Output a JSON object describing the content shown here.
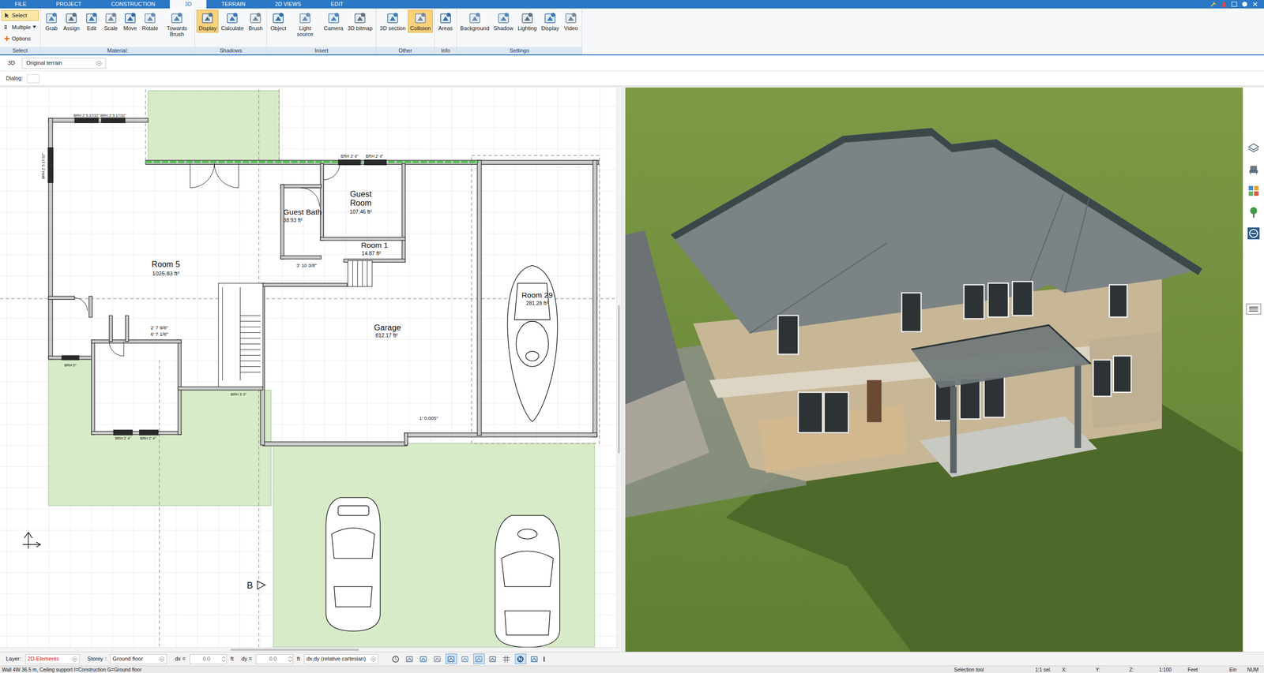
{
  "menu": {
    "tabs": [
      {
        "label": "FILE",
        "selected": false
      },
      {
        "label": "PROJECT",
        "selected": false
      },
      {
        "label": "CONSTRUCTION",
        "selected": false
      },
      {
        "label": "3D",
        "selected": true
      },
      {
        "label": "TERRAIN",
        "selected": false
      },
      {
        "label": "2D VIEWS",
        "selected": false
      },
      {
        "label": "EDIT",
        "selected": false
      }
    ]
  },
  "ribbon": {
    "groups": [
      {
        "label": "Select",
        "kind": "stack",
        "items": [
          {
            "label": "Select",
            "selected": true
          },
          {
            "label": "Multiple",
            "selected": false
          },
          {
            "label": "Options",
            "selected": false
          }
        ]
      },
      {
        "label": "Material:",
        "kind": "buttons",
        "items": [
          {
            "label": "Grab",
            "selected": false
          },
          {
            "label": "Assign",
            "selected": false
          },
          {
            "label": "Edit",
            "selected": false
          },
          {
            "label": "Scale",
            "selected": false
          },
          {
            "label": "Move",
            "selected": false
          },
          {
            "label": "Rotate",
            "selected": false
          },
          {
            "label": "Towards Brush",
            "selected": false
          }
        ]
      },
      {
        "label": "Shadows",
        "kind": "buttons",
        "items": [
          {
            "label": "Display",
            "selected": true
          },
          {
            "label": "Calculate",
            "selected": false
          },
          {
            "label": "Brush",
            "selected": false
          }
        ]
      },
      {
        "label": "Insert",
        "kind": "buttons",
        "items": [
          {
            "label": "Object",
            "selected": false
          },
          {
            "label": "Light source",
            "selected": false
          },
          {
            "label": "Camera",
            "selected": false
          },
          {
            "label": "3D bitmap",
            "selected": false
          }
        ]
      },
      {
        "label": "Other",
        "kind": "buttons",
        "items": [
          {
            "label": "3D section",
            "selected": false
          },
          {
            "label": "Collision",
            "selected": true
          }
        ]
      },
      {
        "label": "Info",
        "kind": "buttons",
        "items": [
          {
            "label": "Areas",
            "selected": false
          }
        ]
      },
      {
        "label": "Settings",
        "kind": "buttons",
        "items": [
          {
            "label": "Background",
            "selected": false
          },
          {
            "label": "Shadow",
            "selected": false
          },
          {
            "label": "Lighting",
            "selected": false
          },
          {
            "label": "Display",
            "selected": false
          },
          {
            "label": "Video",
            "selected": false
          }
        ]
      }
    ]
  },
  "toolbar": {
    "view": "3D",
    "terrain": "Original terrain"
  },
  "dialog": {
    "label": "Dialog:"
  },
  "plan": {
    "labels": [
      "Room 5",
      "1025.83 ft²",
      "Guest Bath",
      "38.93 ft²",
      "Guest",
      "Room",
      "107.46 ft²",
      "Room 1",
      "14.87 ft²",
      "Garage",
      "812.17 ft²",
      "Room 29",
      "281.28 ft²",
      "BRH 2' 5 17/32\"",
      "BRH 2' 5 17/32\"",
      "BRH 2' 5 17/32\"",
      "BRH 2' 4\"",
      "BRH 2' 4\"",
      "BRH 5\"",
      "BRH 2' 4\"",
      "BRH 2' 4\"",
      "BRH 3' 0\"",
      "3' 10 3/8\"",
      "2' 7 9/8\"",
      "6' 7 1/8\"",
      "1' 0.005\"",
      "B"
    ]
  },
  "status_bar": {
    "layer_label": "Layer:",
    "layer": "2D-Elements",
    "storey_label": "Storey :",
    "storey": "Ground floor",
    "dx_label": "dx =",
    "dx": "0.0",
    "dx_unit": "ft",
    "dy_label": "dy =",
    "dy": "0.0",
    "dy_unit": "ft",
    "coord_mode": "dx,dy (relative cartesian)",
    "tools": [
      {
        "selected": false
      },
      {
        "selected": false
      },
      {
        "selected": false
      },
      {
        "selected": false
      },
      {
        "selected": true
      },
      {
        "selected": false
      },
      {
        "selected": true
      },
      {
        "selected": false
      },
      {
        "selected": false
      },
      {
        "selected": true
      },
      {
        "selected": false
      }
    ]
  },
  "status_line": {
    "message": "Wall 4W 36.5 m, Ceiling support I=Construction G=Ground floor",
    "cells": [
      "Selection tool",
      "1:1 sel.",
      "X:",
      "Y:",
      "Z:",
      "1:100",
      "Feet",
      "Ein",
      "NUM"
    ]
  }
}
